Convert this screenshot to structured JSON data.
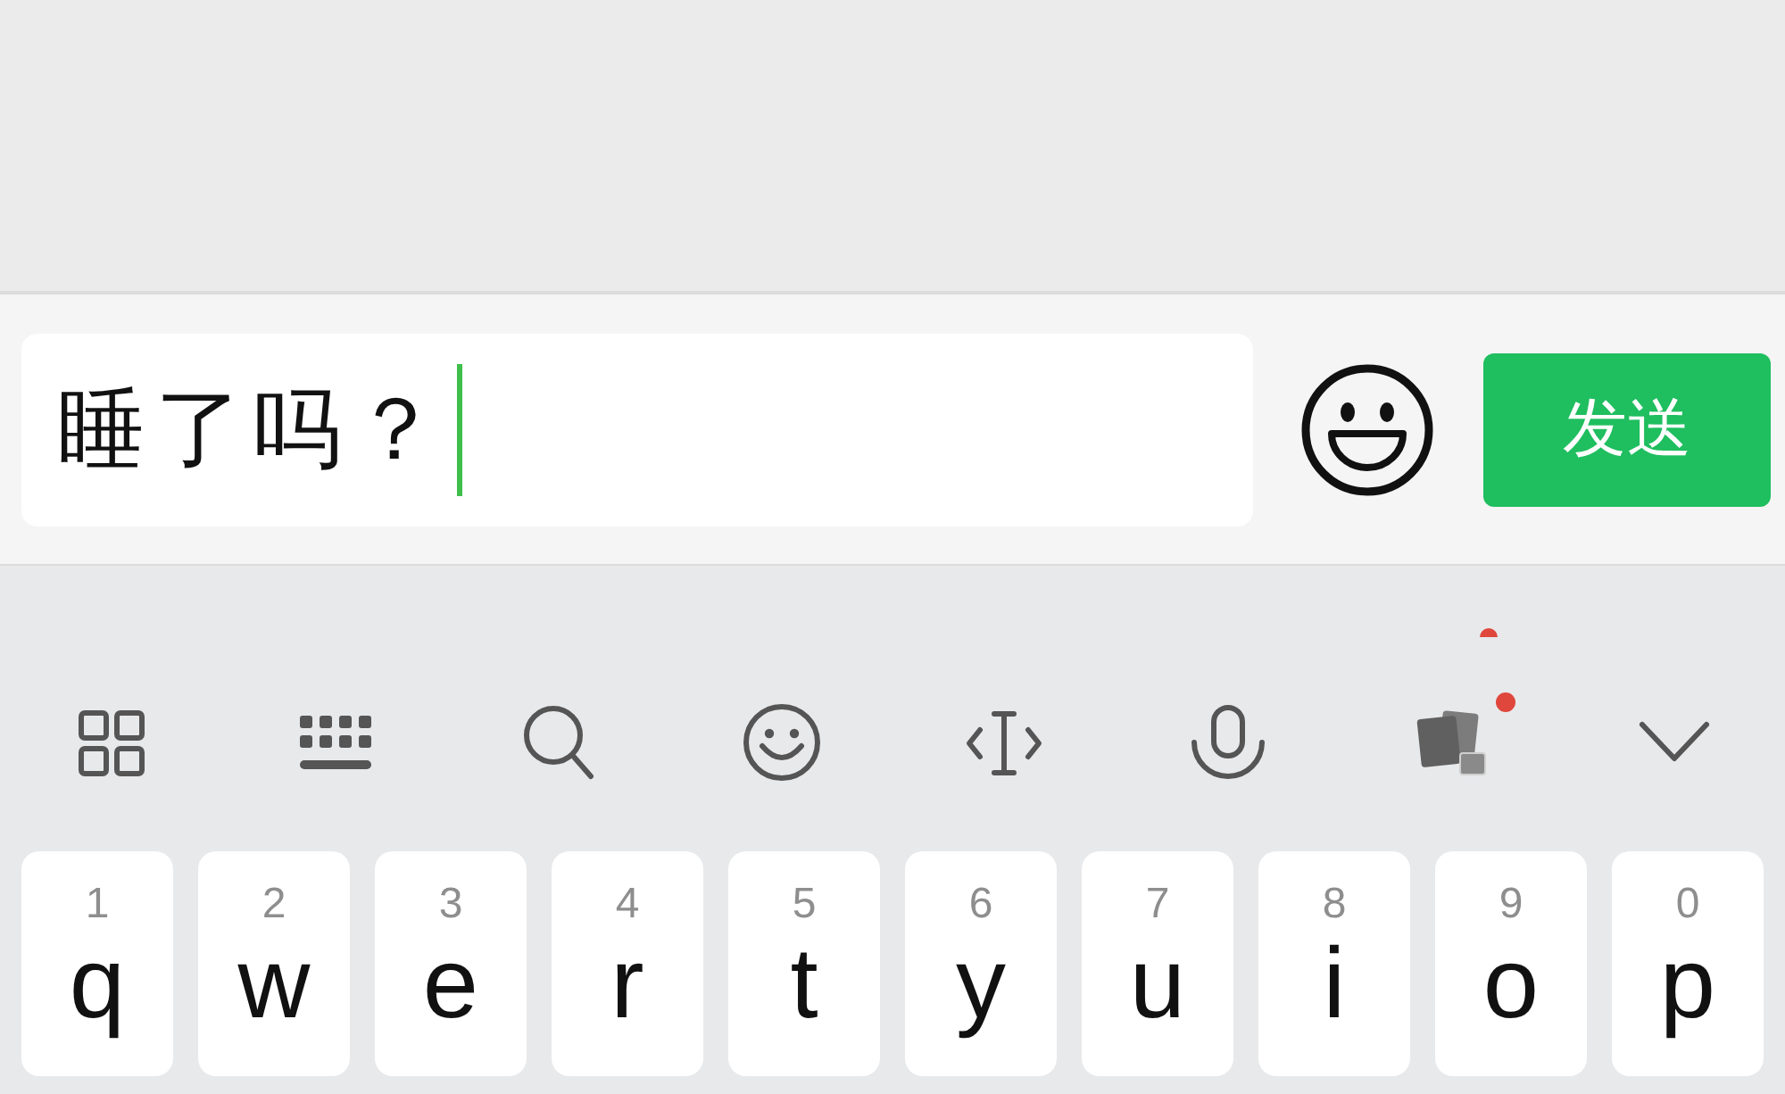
{
  "input_bar": {
    "message": {
      "value": "睡了吗？",
      "focused": true
    },
    "send_button": {
      "label": "发送"
    }
  },
  "keyboard": {
    "toolbar": [
      {
        "kind": "apps",
        "badge": false
      },
      {
        "kind": "keyboard",
        "badge": false
      },
      {
        "kind": "search",
        "badge": false
      },
      {
        "kind": "emoji",
        "badge": false
      },
      {
        "kind": "cursor",
        "badge": false
      },
      {
        "kind": "voice",
        "badge": false
      },
      {
        "kind": "stickers",
        "badge": true
      },
      {
        "kind": "collapse",
        "badge": false
      }
    ],
    "keys": [
      {
        "number": "1",
        "letter": "q"
      },
      {
        "number": "2",
        "letter": "w"
      },
      {
        "number": "3",
        "letter": "e"
      },
      {
        "number": "4",
        "letter": "r"
      },
      {
        "number": "5",
        "letter": "t"
      },
      {
        "number": "6",
        "letter": "y"
      },
      {
        "number": "7",
        "letter": "u"
      },
      {
        "number": "8",
        "letter": "i"
      },
      {
        "number": "9",
        "letter": "o"
      },
      {
        "number": "0",
        "letter": "p"
      }
    ]
  }
}
